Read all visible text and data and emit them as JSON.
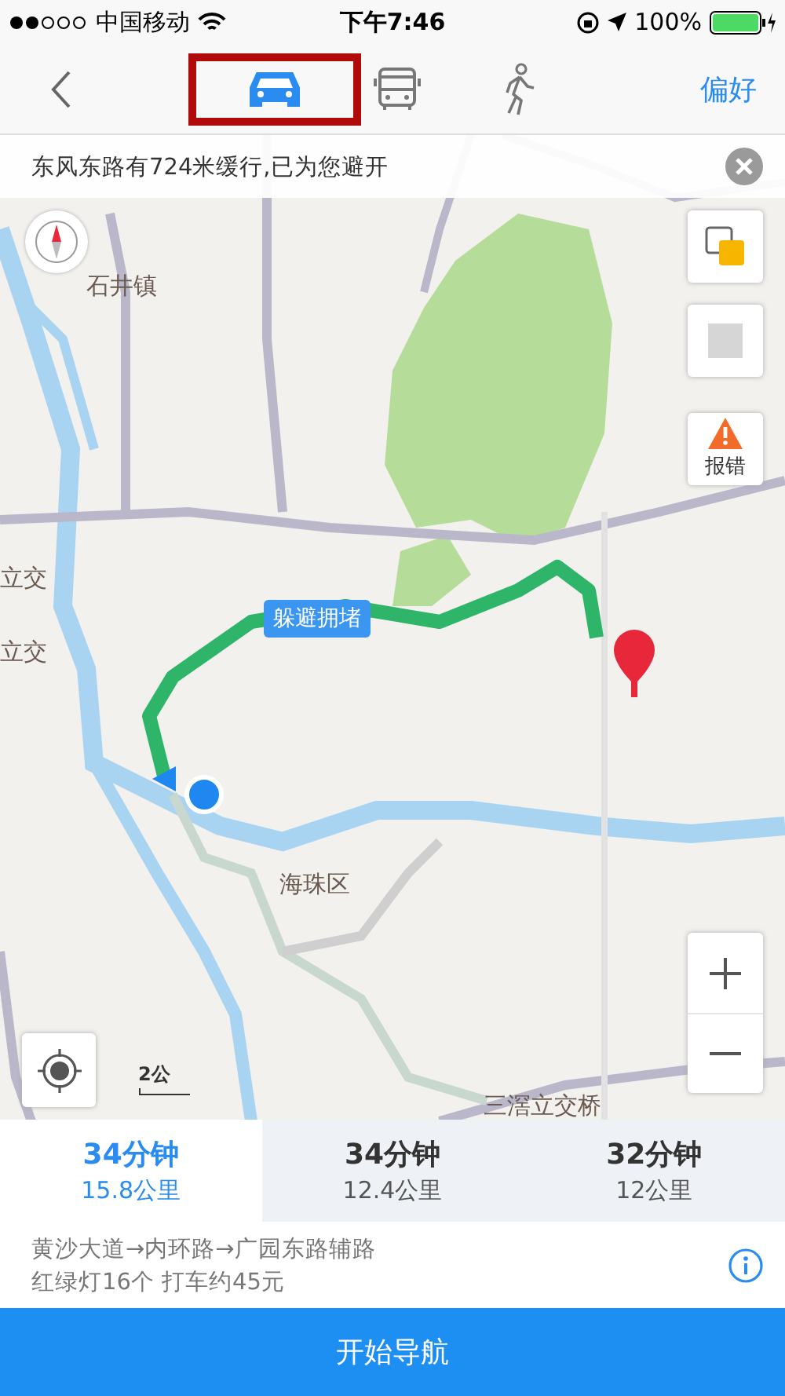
{
  "status_bar": {
    "carrier": "中国移动",
    "time": "下午7:46",
    "battery": "100%"
  },
  "nav": {
    "modes": [
      {
        "kind": "car",
        "selected": true
      },
      {
        "kind": "bus",
        "selected": false
      },
      {
        "kind": "walk",
        "selected": false
      }
    ],
    "preference": "偏好"
  },
  "notice": {
    "text": "东风东路有724米缓行,已为您避开"
  },
  "map": {
    "labels": [
      "石井镇",
      "立交",
      "立交",
      "海珠区",
      "三滘立交桥"
    ],
    "route_tag": "躲避拥堵",
    "scale": "2公",
    "report": "报错"
  },
  "routes": [
    {
      "time": "34分钟",
      "distance": "15.8公里",
      "selected": true
    },
    {
      "time": "34分钟",
      "distance": "12.4公里",
      "selected": false
    },
    {
      "time": "32分钟",
      "distance": "12公里",
      "selected": false
    }
  ],
  "summary": {
    "roads": "黄沙大道→内环路→广园东路辅路",
    "details": "红绿灯16个 打车约45元"
  },
  "start_button": "开始导航"
}
